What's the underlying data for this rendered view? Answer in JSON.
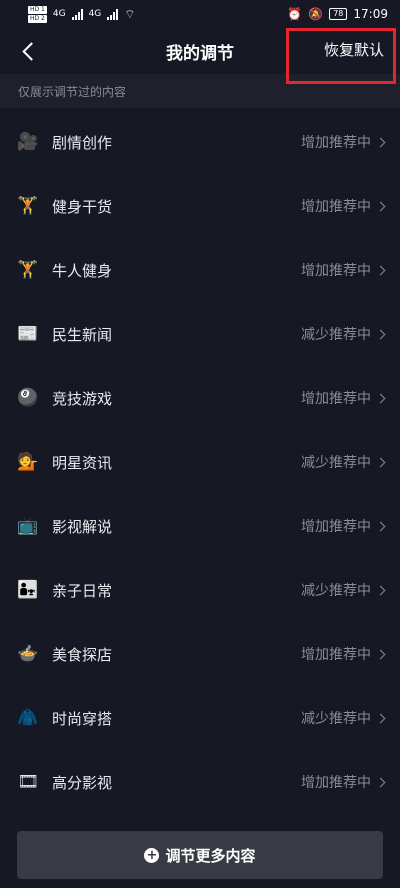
{
  "status_bar": {
    "sim1": "HD 1",
    "sim2": "HD 2",
    "network1": "4G",
    "network2": "4G",
    "battery": "78",
    "time": "17:09"
  },
  "header": {
    "title": "我的调节",
    "reset_label": "恢复默认"
  },
  "hint": "仅展示调节过的内容",
  "items": [
    {
      "icon": "🎥",
      "icon_name": "camera-icon",
      "label": "剧情创作",
      "status": "增加推荐中"
    },
    {
      "icon": "🏋",
      "icon_name": "weightlifter-icon",
      "label": "健身干货",
      "status": "增加推荐中"
    },
    {
      "icon": "🏋",
      "icon_name": "weightlifter-icon",
      "label": "牛人健身",
      "status": "增加推荐中"
    },
    {
      "icon": "📰",
      "icon_name": "newspaper-icon",
      "label": "民生新闻",
      "status": "减少推荐中"
    },
    {
      "icon": "🎱",
      "icon_name": "billiard-ball-icon",
      "label": "竞技游戏",
      "status": "增加推荐中"
    },
    {
      "icon": "💁",
      "icon_name": "person-icon",
      "label": "明星资讯",
      "status": "减少推荐中"
    },
    {
      "icon": "📺",
      "icon_name": "tv-icon",
      "label": "影视解说",
      "status": "增加推荐中"
    },
    {
      "icon": "👨‍👧",
      "icon_name": "family-icon",
      "label": "亲子日常",
      "status": "减少推荐中"
    },
    {
      "icon": "🍲",
      "icon_name": "food-bowl-icon",
      "label": "美食探店",
      "status": "增加推荐中"
    },
    {
      "icon": "🧥",
      "icon_name": "clothing-icon",
      "label": "时尚穿搭",
      "status": "减少推荐中"
    },
    {
      "icon": "🎞",
      "icon_name": "film-icon",
      "label": "高分影视",
      "status": "增加推荐中"
    }
  ],
  "bottom_button": {
    "label": "调节更多内容"
  },
  "colors": {
    "background": "#161823",
    "hint_background": "#1e202b",
    "secondary_text": "#8a8b93",
    "button_background": "#393b44",
    "highlight": "#e6262e"
  }
}
